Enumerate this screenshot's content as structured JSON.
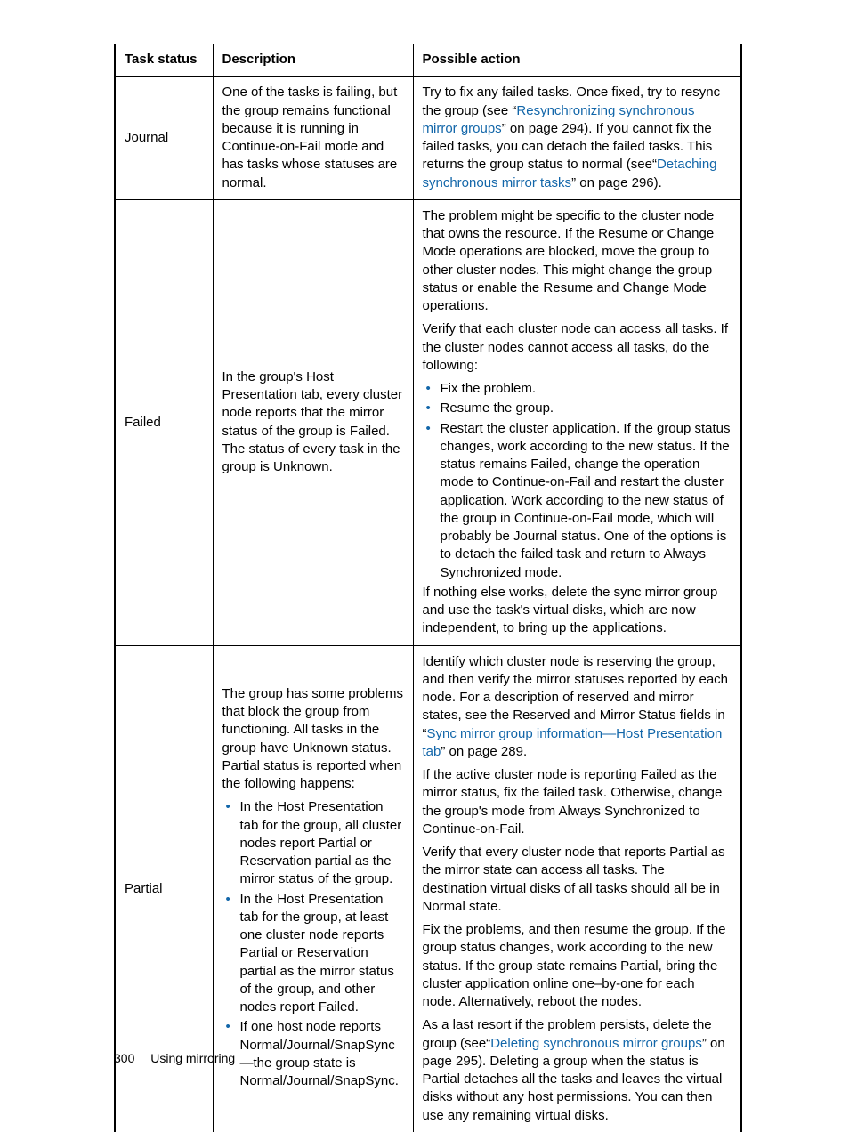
{
  "header": {
    "col1": "Task status",
    "col2": "Description",
    "col3": "Possible action"
  },
  "rows": {
    "journal": {
      "status": "Journal",
      "desc": "One of the tasks is failing, but the group remains functional because it is running in Continue-on-Fail mode and has tasks whose statuses are normal.",
      "action": {
        "pre1": "Try to fix any failed tasks. Once fixed, try to resync the group (see “",
        "link1": "Resynchronizing synchronous mirror groups",
        "mid1": "” on page 294). If you cannot fix the failed tasks, you can detach the failed tasks. This returns the group status to normal (see“",
        "link2": "Detaching synchronous mirror tasks",
        "post1": "” on page 296)."
      }
    },
    "failed": {
      "status": "Failed",
      "desc": "In the group's Host Presentation tab, every cluster node reports that the mirror status of the group is Failed. The status of every task in the group is Unknown.",
      "action": {
        "p1": "The problem might be specific to the cluster node that owns the resource. If the Resume or Change Mode operations are blocked, move the group to other cluster nodes. This might change the group status or enable the Resume and Change Mode operations.",
        "p2": "Verify that each cluster node can access all tasks. If the cluster nodes cannot access all tasks, do the following:",
        "b1": "Fix the problem.",
        "b2": "Resume the group.",
        "b3": "Restart the cluster application. If the group status changes, work according to the new status. If the status remains Failed, change the operation mode to Continue-on-Fail and restart the cluster application. Work according to the new status of the group in Continue-on-Fail mode, which will probably be Journal status. One of the options is to detach the failed task and return to Always Synchronized mode.",
        "p3": "If nothing else works, delete the sync mirror group and use the task's virtual disks, which are now independent, to bring up the applications."
      }
    },
    "partial": {
      "status": "Partial",
      "desc": {
        "p1": "The group has some problems that block the group from functioning. All tasks in the group have Unknown status. Partial status is reported when the following happens:",
        "b1": "In the Host Presentation tab for the group, all cluster nodes report Partial or Reservation partial as the mirror status of the group.",
        "b2": "In the Host Presentation tab for the group, at least one cluster node reports Partial or Reservation partial as the mirror status of the group, and other nodes report Failed.",
        "b3": "If one host node reports Normal/Journal/SnapSync—the group state is Normal/Journal/SnapSync."
      },
      "action": {
        "p1a": "Identify which cluster node is reserving the group, and then verify the mirror statuses reported by each node. For a description of reserved and mirror states, see the Reserved and Mirror Status fields in “",
        "link1": "Sync mirror group information—Host Presentation tab",
        "p1b": "” on page 289.",
        "p2": "If the active cluster node is reporting Failed as the mirror status, fix the failed task. Otherwise, change the group's mode from Always Synchronized to Continue-on-Fail.",
        "p3": "Verify that every cluster node that reports Partial as the mirror state can access all tasks. The destination virtual disks of all tasks should all be in Normal state.",
        "p4": "Fix the problems, and then resume the group. If the group status changes, work according to the new status. If the group state remains Partial, bring the cluster application online one–by-one for each node. Alternatively, reboot the nodes.",
        "p5a": "As a last resort if the problem persists, delete the group (see“",
        "link2": "Deleting synchronous mirror groups",
        "p5b": "” on page 295). Deleting a group when the status is Partial detaches all the tasks and leaves the virtual disks without any host permissions. You can then use any remaining virtual disks."
      }
    }
  },
  "footer": {
    "page_number": "300",
    "section": "Using mirroring"
  }
}
